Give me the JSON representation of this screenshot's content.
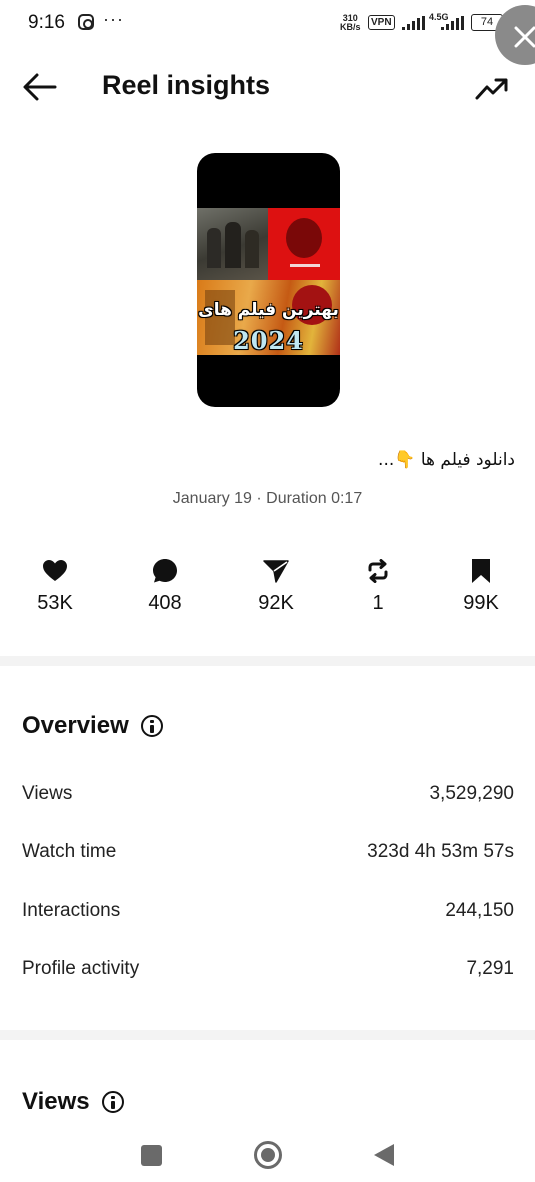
{
  "status_bar": {
    "time": "9:16",
    "dots": "···",
    "net_speed_value": "310",
    "net_speed_unit": "KB/s",
    "vpn": "VPN",
    "network": "4.5G",
    "battery": "74"
  },
  "header": {
    "title": "Reel insights"
  },
  "reel": {
    "poster_text": "بهترین فیلم های",
    "poster_year": "2024",
    "caption": "دانلود فیلم ها 👇...",
    "meta": "January 19 · Duration 0:17"
  },
  "stats": [
    {
      "icon": "heart-icon",
      "value": "53K"
    },
    {
      "icon": "comment-icon",
      "value": "408"
    },
    {
      "icon": "share-icon",
      "value": "92K"
    },
    {
      "icon": "repost-icon",
      "value": "1"
    },
    {
      "icon": "bookmark-icon",
      "value": "99K"
    }
  ],
  "overview": {
    "title": "Overview",
    "rows": [
      {
        "label": "Views",
        "value": "3,529,290"
      },
      {
        "label": "Watch time",
        "value": "323d 4h 53m 57s"
      },
      {
        "label": "Interactions",
        "value": "244,150"
      },
      {
        "label": "Profile activity",
        "value": "7,291"
      }
    ]
  },
  "views_section": {
    "title": "Views"
  }
}
